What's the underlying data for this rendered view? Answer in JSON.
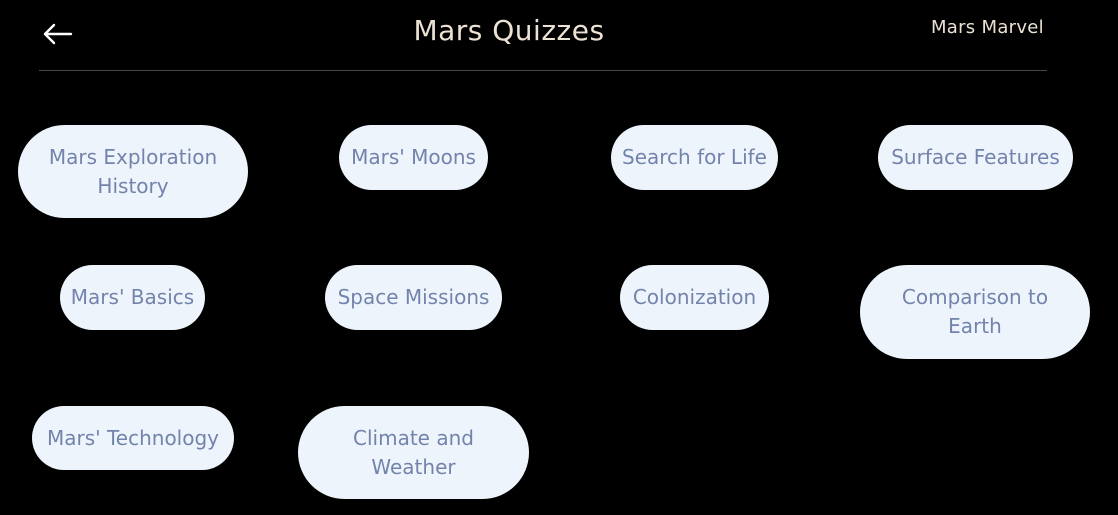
{
  "header": {
    "back_icon": "arrow-left-icon",
    "title": "Mars Quizzes",
    "brand": "Mars Marvel"
  },
  "colors": {
    "background": "#000000",
    "title_text": "#ece2d4",
    "pill_background": "#eef4fc",
    "pill_text": "#7384ac"
  },
  "quizzes": [
    {
      "label": "Mars Exploration History"
    },
    {
      "label": "Mars' Moons"
    },
    {
      "label": "Search for Life"
    },
    {
      "label": "Surface Features"
    },
    {
      "label": "Mars' Basics"
    },
    {
      "label": "Space Missions"
    },
    {
      "label": "Colonization"
    },
    {
      "label": "Comparison to Earth"
    },
    {
      "label": "Mars' Technology"
    },
    {
      "label": "Climate and Weather"
    }
  ]
}
